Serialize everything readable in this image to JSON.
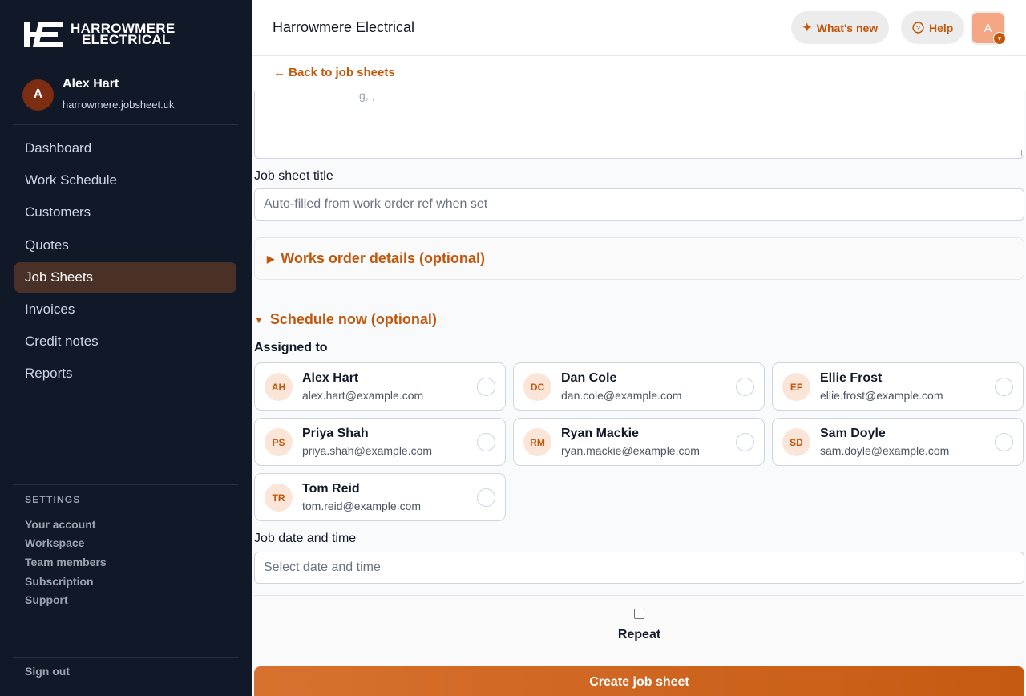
{
  "brand": {
    "line1": "HARROWMERE",
    "line2": "ELECTRICAL",
    "mark": "HE"
  },
  "user": {
    "initial": "A",
    "name": "Alex Hart",
    "domain": "harrowmere.jobsheet.uk"
  },
  "nav": [
    {
      "label": "Dashboard",
      "active": false
    },
    {
      "label": "Work Schedule",
      "active": false
    },
    {
      "label": "Customers",
      "active": false
    },
    {
      "label": "Quotes",
      "active": false
    },
    {
      "label": "Job Sheets",
      "active": true
    },
    {
      "label": "Invoices",
      "active": false
    },
    {
      "label": "Credit notes",
      "active": false
    },
    {
      "label": "Reports",
      "active": false
    }
  ],
  "settings": {
    "heading": "SETTINGS",
    "items": [
      "Your account",
      "Workspace",
      "Team members",
      "Subscription",
      "Support"
    ],
    "signout": "Sign out"
  },
  "header": {
    "title": "Harrowmere Electrical",
    "whats_new": "What's new",
    "help": "Help",
    "avatar_initial": "A"
  },
  "back_link": "← Back to job sheets",
  "form": {
    "textarea_fragment": "g,         ,",
    "job_title_label": "Job sheet title",
    "job_title_placeholder": "Auto-filled from work order ref when set",
    "works_order_toggle": "Works order details (optional)",
    "schedule_toggle": "Schedule now (optional)",
    "assigned_label": "Assigned to",
    "date_label": "Job date and time",
    "date_placeholder": "Select date and time",
    "repeat_label": "Repeat",
    "submit_label": "Create job sheet"
  },
  "team": [
    {
      "initials": "AH",
      "name": "Alex Hart",
      "email": "alex.hart@example.com"
    },
    {
      "initials": "DC",
      "name": "Dan Cole",
      "email": "dan.cole@example.com"
    },
    {
      "initials": "EF",
      "name": "Ellie Frost",
      "email": "ellie.frost@example.com"
    },
    {
      "initials": "PS",
      "name": "Priya Shah",
      "email": "priya.shah@example.com"
    },
    {
      "initials": "RM",
      "name": "Ryan Mackie",
      "email": "ryan.mackie@example.com"
    },
    {
      "initials": "SD",
      "name": "Sam Doyle",
      "email": "sam.doyle@example.com"
    },
    {
      "initials": "TR",
      "name": "Tom Reid",
      "email": "tom.reid@example.com"
    }
  ],
  "colors": {
    "accent": "#c2570c",
    "sidebar": "#111827",
    "active_nav": "#4a3128"
  }
}
